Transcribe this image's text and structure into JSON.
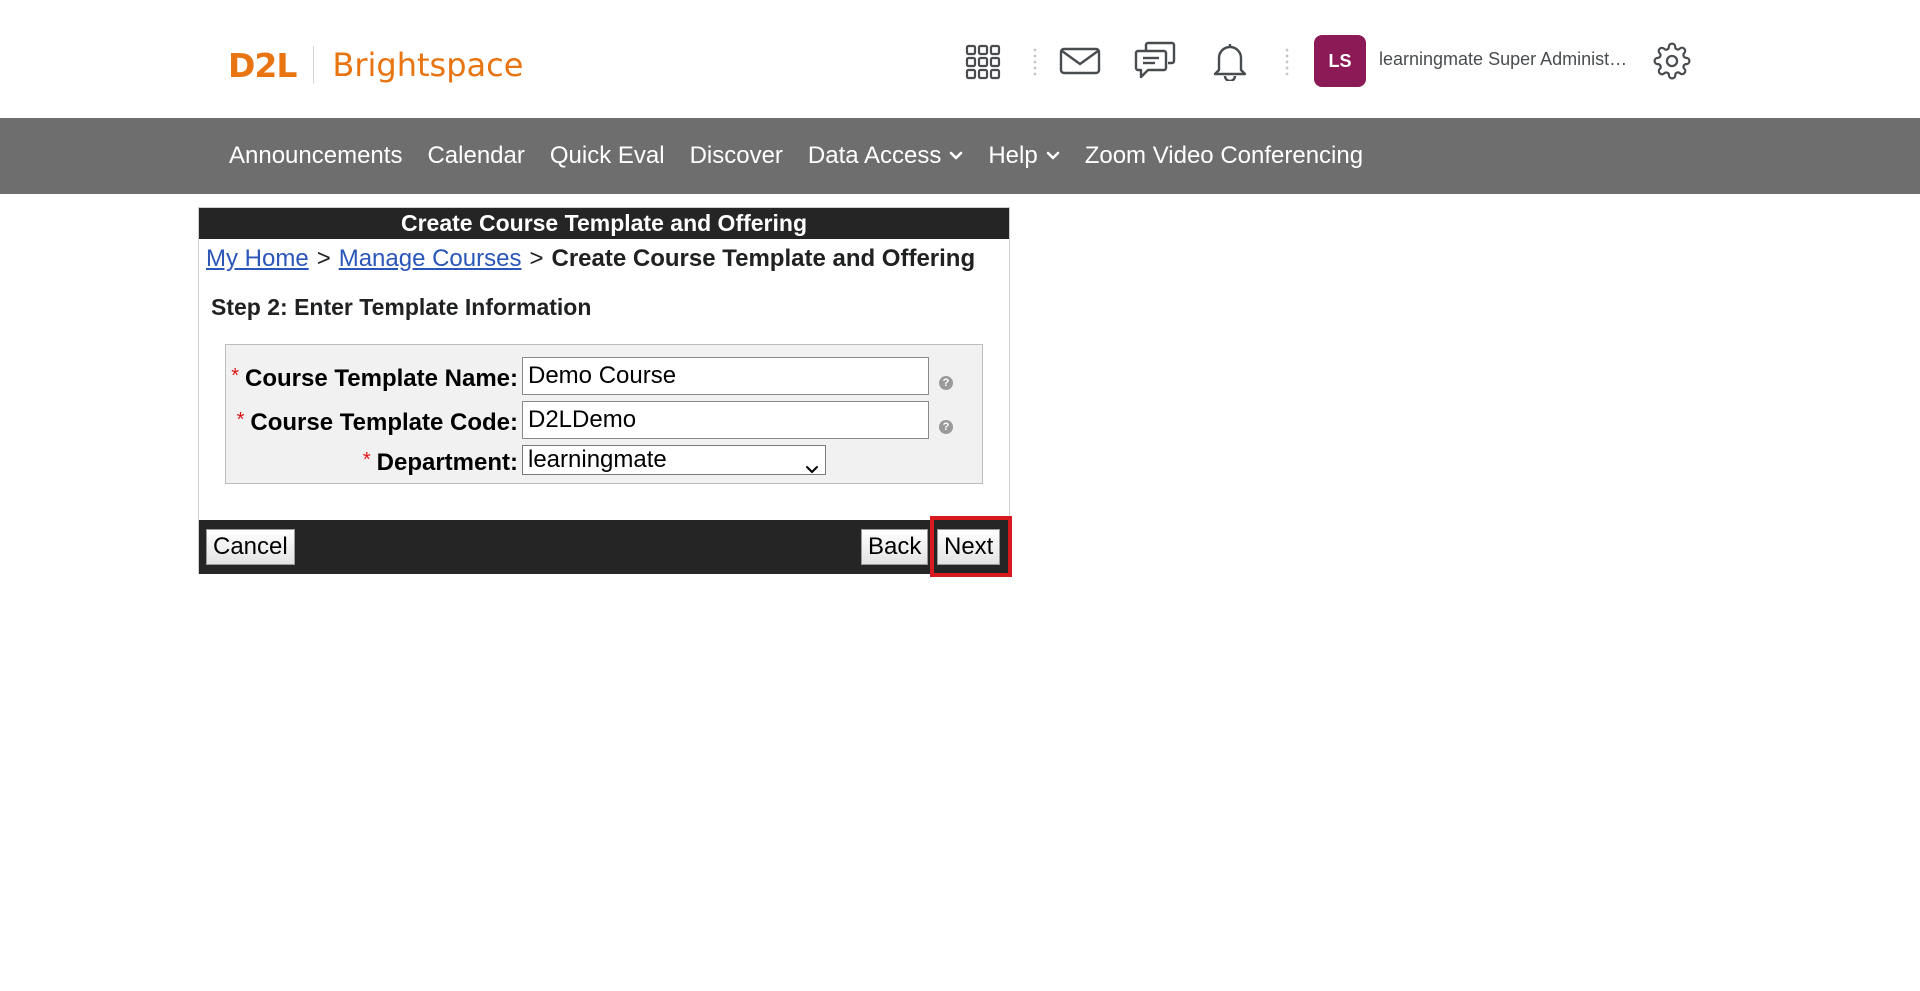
{
  "header": {
    "logo_d2l": "D2L",
    "logo_product": "Brightspace",
    "avatar_initials": "LS",
    "user_name": "learningmate Super Administra...",
    "icons": [
      "app-grid-icon",
      "mail-icon",
      "chat-icon",
      "bell-icon",
      "gear-icon"
    ]
  },
  "nav": {
    "items": [
      {
        "label": "Announcements"
      },
      {
        "label": "Calendar"
      },
      {
        "label": "Quick Eval"
      },
      {
        "label": "Discover"
      },
      {
        "label": "Data Access"
      },
      {
        "label": "Help"
      },
      {
        "label": "Zoom Video Conferencing"
      }
    ]
  },
  "panel": {
    "title": "Create Course Template and Offering",
    "breadcrumb": {
      "home": "My Home",
      "separator": ">",
      "manage": "Manage Courses",
      "current": "Create Course Template and Offering"
    },
    "step_title": "Step 2: Enter Template Information",
    "required_marker": "*",
    "fields": {
      "name_label": "Course Template Name:",
      "name_value": "Demo Course",
      "code_label": "Course Template Code:",
      "code_value": "D2LDemo",
      "dept_label": "Department:",
      "dept_value": "learningmate",
      "help_glyph": "?"
    },
    "buttons": {
      "cancel": "Cancel",
      "back": "Back",
      "next": "Next"
    }
  },
  "colors": {
    "brand_orange": "#e87511",
    "nav_bg": "#6e6e6e",
    "panel_bar": "#252525",
    "avatar_bg": "#8b1a57",
    "highlight": "#d71920",
    "link": "#2a56b8"
  }
}
